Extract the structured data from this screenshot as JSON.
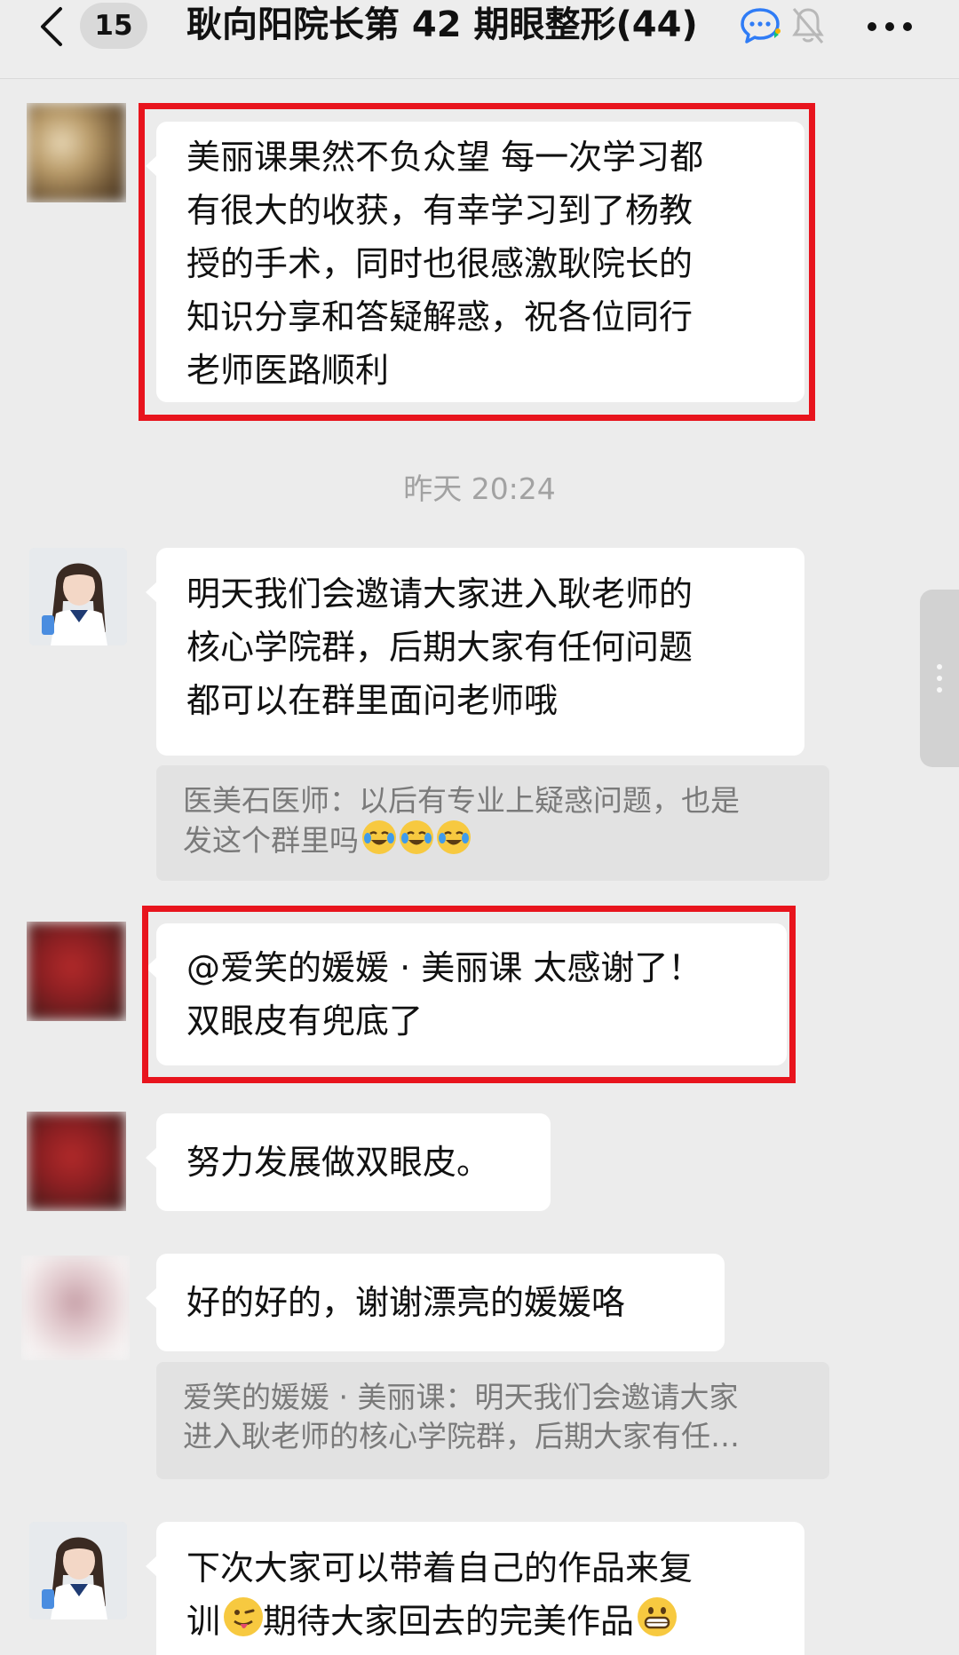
{
  "header": {
    "unread_count": "15",
    "title": "耿向阳院长第 42 期眼整形(44)"
  },
  "messages": [
    {
      "lines": [
        "美丽课果然不负众望 每一次学习都",
        "有很大的收获，有幸学习到了杨教",
        "授的手术，同时也很感激耿院长的",
        "知识分享和答疑解惑，祝各位同行",
        "老师医路顺利"
      ]
    },
    {
      "lines": [
        "明天我们会邀请大家进入耿老师的",
        "核心学院群，后期大家有任何问题",
        "都可以在群里面问老师哦"
      ]
    },
    {
      "lines": [
        "@爱笑的媛媛 · 美丽课 太感谢了！",
        "双眼皮有兜底了"
      ]
    },
    {
      "lines": [
        "努力发展做双眼皮。"
      ]
    },
    {
      "lines": [
        "好的好的，谢谢漂亮的媛媛咯"
      ]
    },
    {
      "lines": [
        "下次大家可以带着自己的作品来复",
        "训",
        "期待大家回去的完美作品"
      ]
    }
  ],
  "quotes": [
    {
      "lines": [
        "医美石医师：以后有专业上疑惑问题，也是",
        "发这个群里吗"
      ],
      "emoji": [
        "face-with-tears-of-joy",
        "face-with-tears-of-joy",
        "face-with-tears-of-joy"
      ]
    },
    {
      "lines": [
        "爱笑的媛媛 · 美丽课：明天我们会邀请大家",
        "进入耿老师的核心学院群，后期大家有任…"
      ]
    }
  ],
  "timestamp": "昨天 20:24",
  "icons": [
    "back-icon",
    "live-chat-icon",
    "mute-bell-icon",
    "more-icon",
    "winking-face-tongue-emoji",
    "grinning-face-emoji"
  ],
  "colors": {
    "background": "#ececec",
    "bubble": "#ffffff",
    "quote": "#e2e2e2",
    "highlight_border": "#e8141d",
    "timestamp": "#a2a2a2"
  }
}
